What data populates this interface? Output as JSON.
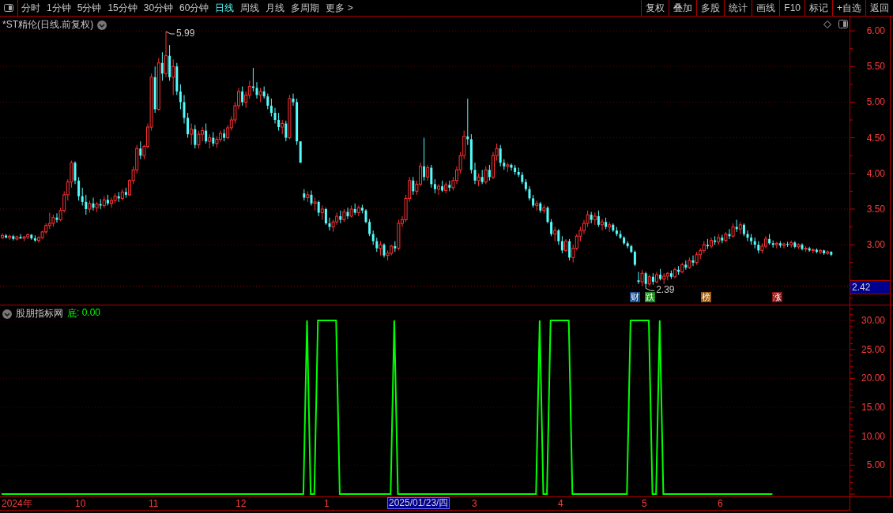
{
  "toolbar": {
    "periods": [
      {
        "label": "分时",
        "selected": false
      },
      {
        "label": "1分钟",
        "selected": false
      },
      {
        "label": "5分钟",
        "selected": false
      },
      {
        "label": "15分钟",
        "selected": false
      },
      {
        "label": "30分钟",
        "selected": false
      },
      {
        "label": "60分钟",
        "selected": false
      },
      {
        "label": "日线",
        "selected": true
      },
      {
        "label": "周线",
        "selected": false
      },
      {
        "label": "月线",
        "selected": false
      },
      {
        "label": "多周期",
        "selected": false
      },
      {
        "label": "更多 >",
        "selected": false
      }
    ],
    "actions": [
      "复权",
      "叠加",
      "多股",
      "统计",
      "画线",
      "F10",
      "标记",
      "+自选",
      "返回"
    ]
  },
  "price_panel": {
    "title": "*ST精伦(日线.前复权)",
    "high_note": "5.99",
    "low_note": "2.39",
    "markers": [
      {
        "label": "财",
        "color": "#1c4f8c"
      },
      {
        "label": "跌",
        "color": "#1c8c1c"
      },
      {
        "label": "榜",
        "color": "#a05a10"
      },
      {
        "label": "涨",
        "color": "#8c1010"
      }
    ],
    "chart_data": {
      "type": "candlestick",
      "ylim": [
        2.16,
        6.2
      ],
      "grid": true,
      "ref_lines": [
        {
          "axis": "y",
          "value": 2.42,
          "label": "2.42",
          "color": "#a00000"
        }
      ],
      "yticks": [
        {
          "value": 6,
          "label": "6.00"
        },
        {
          "value": 5.5,
          "label": "5.50"
        },
        {
          "value": 5,
          "label": "5.00"
        },
        {
          "value": 4.5,
          "label": "4.50"
        },
        {
          "value": 4,
          "label": "4.00"
        },
        {
          "value": 3.5,
          "label": "3.50"
        },
        {
          "value": 3,
          "label": "3.00"
        }
      ],
      "ohlc": [
        [
          3.1,
          3.16,
          3.08,
          3.13
        ],
        [
          3.13,
          3.15,
          3.09,
          3.1
        ],
        [
          3.1,
          3.14,
          3.07,
          3.12
        ],
        [
          3.12,
          3.14,
          3.06,
          3.08
        ],
        [
          3.08,
          3.13,
          3.06,
          3.11
        ],
        [
          3.11,
          3.15,
          3.08,
          3.09
        ],
        [
          3.09,
          3.12,
          3.05,
          3.11
        ],
        [
          3.11,
          3.16,
          3.08,
          3.14
        ],
        [
          3.14,
          3.15,
          3.07,
          3.09
        ],
        [
          3.09,
          3.13,
          3.04,
          3.06
        ],
        [
          3.06,
          3.12,
          3.03,
          3.1
        ],
        [
          3.1,
          3.2,
          3.08,
          3.18
        ],
        [
          3.18,
          3.3,
          3.15,
          3.27
        ],
        [
          3.27,
          3.45,
          3.22,
          3.3
        ],
        [
          3.3,
          3.42,
          3.25,
          3.38
        ],
        [
          3.38,
          3.44,
          3.31,
          3.35
        ],
        [
          3.35,
          3.52,
          3.33,
          3.48
        ],
        [
          3.48,
          3.75,
          3.45,
          3.7
        ],
        [
          3.7,
          3.92,
          3.62,
          3.88
        ],
        [
          3.88,
          4.18,
          3.8,
          4.15
        ],
        [
          4.15,
          4.17,
          3.85,
          3.9
        ],
        [
          3.9,
          3.95,
          3.62,
          3.68
        ],
        [
          3.68,
          3.8,
          3.55,
          3.6
        ],
        [
          3.6,
          3.7,
          3.42,
          3.5
        ],
        [
          3.5,
          3.62,
          3.45,
          3.58
        ],
        [
          3.58,
          3.66,
          3.48,
          3.52
        ],
        [
          3.52,
          3.6,
          3.46,
          3.57
        ],
        [
          3.57,
          3.64,
          3.5,
          3.55
        ],
        [
          3.55,
          3.68,
          3.52,
          3.63
        ],
        [
          3.63,
          3.7,
          3.55,
          3.58
        ],
        [
          3.58,
          3.66,
          3.52,
          3.62
        ],
        [
          3.62,
          3.72,
          3.58,
          3.68
        ],
        [
          3.68,
          3.74,
          3.6,
          3.65
        ],
        [
          3.65,
          3.78,
          3.62,
          3.74
        ],
        [
          3.74,
          3.8,
          3.66,
          3.7
        ],
        [
          3.7,
          3.92,
          3.68,
          3.9
        ],
        [
          3.9,
          4.1,
          3.85,
          4.05
        ],
        [
          4.05,
          4.4,
          4.0,
          4.35
        ],
        [
          4.35,
          4.45,
          4.2,
          4.25
        ],
        [
          4.25,
          4.4,
          4.2,
          4.38
        ],
        [
          4.38,
          4.7,
          4.35,
          4.65
        ],
        [
          4.65,
          5.4,
          4.6,
          5.35
        ],
        [
          5.35,
          5.5,
          4.85,
          4.9
        ],
        [
          4.9,
          5.62,
          4.88,
          5.55
        ],
        [
          5.55,
          5.7,
          5.3,
          5.4
        ],
        [
          5.4,
          5.99,
          5.35,
          5.65
        ],
        [
          5.65,
          5.8,
          5.3,
          5.35
        ],
        [
          5.35,
          5.6,
          5.1,
          5.5
        ],
        [
          5.5,
          5.55,
          5.1,
          5.15
        ],
        [
          5.15,
          5.25,
          4.9,
          5.0
        ],
        [
          5.0,
          5.1,
          4.7,
          4.78
        ],
        [
          4.78,
          4.85,
          4.5,
          4.55
        ],
        [
          4.55,
          4.7,
          4.4,
          4.62
        ],
        [
          4.62,
          4.68,
          4.35,
          4.4
        ],
        [
          4.4,
          4.6,
          4.35,
          4.55
        ],
        [
          4.55,
          4.65,
          4.45,
          4.6
        ],
        [
          4.6,
          4.7,
          4.42,
          4.45
        ],
        [
          4.45,
          4.55,
          4.35,
          4.5
        ],
        [
          4.5,
          4.58,
          4.38,
          4.42
        ],
        [
          4.42,
          4.52,
          4.36,
          4.48
        ],
        [
          4.48,
          4.6,
          4.44,
          4.56
        ],
        [
          4.56,
          4.62,
          4.45,
          4.5
        ],
        [
          4.5,
          4.68,
          4.48,
          4.64
        ],
        [
          4.64,
          4.8,
          4.6,
          4.75
        ],
        [
          4.75,
          5.0,
          4.7,
          4.95
        ],
        [
          4.95,
          5.2,
          4.9,
          5.15
        ],
        [
          5.15,
          5.22,
          4.95,
          5.0
        ],
        [
          5.0,
          5.15,
          4.92,
          5.1
        ],
        [
          5.1,
          5.3,
          5.05,
          5.22
        ],
        [
          5.22,
          5.48,
          5.15,
          5.2
        ],
        [
          5.2,
          5.28,
          5.05,
          5.1
        ],
        [
          5.1,
          5.2,
          5.0,
          5.15
        ],
        [
          5.15,
          5.22,
          5.05,
          5.08
        ],
        [
          5.08,
          5.12,
          4.9,
          4.95
        ],
        [
          4.95,
          5.05,
          4.8,
          4.85
        ],
        [
          4.85,
          4.92,
          4.7,
          4.75
        ],
        [
          4.75,
          4.85,
          4.6,
          4.65
        ],
        [
          4.65,
          4.75,
          4.55,
          4.7
        ],
        [
          4.7,
          4.74,
          4.45,
          4.5
        ],
        [
          4.5,
          5.1,
          4.48,
          5.05
        ],
        [
          5.05,
          5.12,
          4.95,
          5.0
        ],
        [
          5.0,
          5.05,
          4.4,
          4.45
        ],
        [
          4.45,
          4.45,
          4.15,
          4.15
        ],
        [
          3.72,
          3.78,
          3.62,
          3.66
        ],
        [
          3.66,
          3.75,
          3.6,
          3.7
        ],
        [
          3.7,
          3.76,
          3.55,
          3.58
        ],
        [
          3.58,
          3.66,
          3.48,
          3.6
        ],
        [
          3.6,
          3.62,
          3.4,
          3.45
        ],
        [
          3.45,
          3.55,
          3.35,
          3.5
        ],
        [
          3.5,
          3.52,
          3.28,
          3.3
        ],
        [
          3.3,
          3.38,
          3.2,
          3.25
        ],
        [
          3.25,
          3.35,
          3.18,
          3.32
        ],
        [
          3.32,
          3.45,
          3.28,
          3.4
        ],
        [
          3.4,
          3.48,
          3.3,
          3.35
        ],
        [
          3.35,
          3.5,
          3.32,
          3.46
        ],
        [
          3.46,
          3.52,
          3.36,
          3.4
        ],
        [
          3.4,
          3.55,
          3.38,
          3.5
        ],
        [
          3.5,
          3.58,
          3.42,
          3.45
        ],
        [
          3.45,
          3.55,
          3.4,
          3.52
        ],
        [
          3.52,
          3.56,
          3.44,
          3.48
        ],
        [
          3.48,
          3.5,
          3.3,
          3.32
        ],
        [
          3.32,
          3.36,
          3.12,
          3.15
        ],
        [
          3.15,
          3.2,
          3.0,
          3.05
        ],
        [
          3.05,
          3.1,
          2.9,
          2.95
        ],
        [
          2.95,
          3.05,
          2.85,
          3.0
        ],
        [
          3.0,
          3.02,
          2.82,
          2.85
        ],
        [
          2.85,
          2.92,
          2.78,
          2.88
        ],
        [
          2.88,
          3.0,
          2.85,
          2.98
        ],
        [
          2.98,
          3.05,
          2.9,
          2.95
        ],
        [
          2.95,
          3.35,
          2.92,
          3.3
        ],
        [
          3.3,
          3.4,
          3.25,
          3.35
        ],
        [
          3.35,
          3.7,
          3.32,
          3.65
        ],
        [
          3.65,
          3.95,
          3.6,
          3.9
        ],
        [
          3.9,
          3.95,
          3.7,
          3.75
        ],
        [
          3.75,
          3.9,
          3.7,
          3.85
        ],
        [
          3.85,
          4.15,
          3.82,
          4.1
        ],
        [
          4.1,
          4.5,
          3.9,
          3.95
        ],
        [
          3.95,
          4.12,
          3.9,
          4.08
        ],
        [
          4.08,
          4.12,
          3.8,
          3.85
        ],
        [
          3.85,
          3.92,
          3.72,
          3.78
        ],
        [
          3.78,
          3.85,
          3.7,
          3.82
        ],
        [
          3.82,
          3.9,
          3.74,
          3.76
        ],
        [
          3.76,
          3.88,
          3.72,
          3.84
        ],
        [
          3.84,
          3.9,
          3.75,
          3.8
        ],
        [
          3.8,
          3.95,
          3.76,
          3.9
        ],
        [
          3.9,
          4.1,
          3.85,
          4.05
        ],
        [
          4.05,
          4.3,
          4.0,
          4.25
        ],
        [
          4.25,
          4.6,
          4.2,
          4.52
        ],
        [
          4.52,
          5.05,
          4.4,
          4.48
        ],
        [
          4.48,
          4.55,
          4.0,
          4.05
        ],
        [
          4.05,
          4.15,
          3.85,
          3.9
        ],
        [
          3.9,
          4.0,
          3.82,
          3.95
        ],
        [
          3.95,
          4.05,
          3.85,
          3.88
        ],
        [
          3.88,
          4.1,
          3.85,
          4.05
        ],
        [
          4.05,
          4.12,
          3.9,
          3.95
        ],
        [
          3.95,
          4.3,
          3.92,
          4.25
        ],
        [
          4.25,
          4.42,
          4.18,
          4.35
        ],
        [
          4.35,
          4.4,
          4.1,
          4.15
        ],
        [
          4.15,
          4.2,
          4.05,
          4.1
        ],
        [
          4.1,
          4.15,
          4.02,
          4.12
        ],
        [
          4.12,
          4.14,
          4.04,
          4.08
        ],
        [
          4.08,
          4.12,
          3.98,
          4.02
        ],
        [
          4.02,
          4.08,
          3.95,
          3.98
        ],
        [
          3.98,
          4.02,
          3.85,
          3.88
        ],
        [
          3.88,
          3.92,
          3.75,
          3.78
        ],
        [
          3.78,
          3.82,
          3.62,
          3.65
        ],
        [
          3.65,
          3.7,
          3.52,
          3.55
        ],
        [
          3.55,
          3.62,
          3.48,
          3.58
        ],
        [
          3.58,
          3.6,
          3.45,
          3.48
        ],
        [
          3.48,
          3.56,
          3.44,
          3.52
        ],
        [
          3.52,
          3.54,
          3.3,
          3.32
        ],
        [
          3.32,
          3.36,
          3.12,
          3.15
        ],
        [
          3.15,
          3.25,
          3.05,
          3.2
        ],
        [
          3.2,
          3.22,
          3.0,
          3.05
        ],
        [
          3.05,
          3.12,
          2.88,
          2.92
        ],
        [
          2.92,
          3.08,
          2.9,
          3.05
        ],
        [
          3.05,
          3.08,
          2.78,
          2.82
        ],
        [
          2.82,
          3.0,
          2.75,
          2.95
        ],
        [
          2.95,
          3.15,
          2.92,
          3.12
        ],
        [
          3.12,
          3.25,
          3.05,
          3.2
        ],
        [
          3.2,
          3.35,
          3.15,
          3.3
        ],
        [
          3.3,
          3.48,
          3.25,
          3.42
        ],
        [
          3.42,
          3.46,
          3.3,
          3.35
        ],
        [
          3.35,
          3.45,
          3.28,
          3.4
        ],
        [
          3.4,
          3.48,
          3.25,
          3.28
        ],
        [
          3.28,
          3.36,
          3.2,
          3.32
        ],
        [
          3.32,
          3.38,
          3.22,
          3.25
        ],
        [
          3.25,
          3.32,
          3.18,
          3.28
        ],
        [
          3.28,
          3.3,
          3.18,
          3.2
        ],
        [
          3.2,
          3.25,
          3.12,
          3.15
        ],
        [
          3.15,
          3.2,
          3.08,
          3.1
        ],
        [
          3.1,
          3.12,
          3.0,
          3.02
        ],
        [
          3.02,
          3.05,
          2.95,
          2.98
        ],
        [
          2.98,
          3.0,
          2.88,
          2.9
        ],
        [
          2.9,
          2.92,
          2.7,
          2.72
        ],
        [
          2.5,
          2.62,
          2.45,
          2.48
        ],
        [
          2.48,
          2.65,
          2.42,
          2.6
        ],
        [
          2.6,
          2.62,
          2.39,
          2.45
        ],
        [
          2.45,
          2.58,
          2.42,
          2.55
        ],
        [
          2.55,
          2.6,
          2.44,
          2.48
        ],
        [
          2.48,
          2.62,
          2.46,
          2.58
        ],
        [
          2.58,
          2.66,
          2.5,
          2.52
        ],
        [
          2.52,
          2.6,
          2.45,
          2.56
        ],
        [
          2.56,
          2.62,
          2.5,
          2.6
        ],
        [
          2.6,
          2.64,
          2.52,
          2.55
        ],
        [
          2.55,
          2.68,
          2.53,
          2.65
        ],
        [
          2.65,
          2.7,
          2.58,
          2.62
        ],
        [
          2.62,
          2.75,
          2.6,
          2.72
        ],
        [
          2.72,
          2.78,
          2.65,
          2.68
        ],
        [
          2.68,
          2.82,
          2.66,
          2.78
        ],
        [
          2.78,
          2.85,
          2.7,
          2.75
        ],
        [
          2.75,
          2.9,
          2.72,
          2.86
        ],
        [
          2.86,
          2.95,
          2.8,
          2.92
        ],
        [
          2.92,
          3.05,
          2.88,
          3.0
        ],
        [
          3.0,
          3.08,
          2.94,
          2.98
        ],
        [
          2.98,
          3.1,
          2.95,
          3.06
        ],
        [
          3.06,
          3.12,
          3.0,
          3.04
        ],
        [
          3.04,
          3.15,
          3.0,
          3.1
        ],
        [
          3.1,
          3.14,
          3.02,
          3.06
        ],
        [
          3.06,
          3.18,
          3.04,
          3.15
        ],
        [
          3.15,
          3.22,
          3.08,
          3.12
        ],
        [
          3.12,
          3.3,
          3.1,
          3.25
        ],
        [
          3.25,
          3.35,
          3.18,
          3.22
        ],
        [
          3.22,
          3.32,
          3.15,
          3.28
        ],
        [
          3.28,
          3.3,
          3.12,
          3.15
        ],
        [
          3.15,
          3.2,
          3.05,
          3.1
        ],
        [
          3.1,
          3.15,
          3.0,
          3.05
        ],
        [
          3.05,
          3.1,
          2.95,
          3.0
        ],
        [
          3.0,
          3.05,
          2.88,
          2.92
        ],
        [
          2.92,
          3.02,
          2.88,
          2.98
        ],
        [
          2.98,
          3.12,
          2.95,
          3.08
        ],
        [
          3.08,
          3.15,
          3.0,
          3.02
        ],
        [
          3.02,
          3.06,
          2.96,
          3.0
        ],
        [
          3.0,
          3.04,
          2.95,
          3.02
        ],
        [
          3.02,
          3.05,
          2.96,
          2.99
        ],
        [
          2.99,
          3.03,
          2.95,
          3.01
        ],
        [
          3.01,
          3.04,
          2.97,
          3.0
        ],
        [
          3.0,
          3.06,
          2.96,
          3.03
        ],
        [
          3.03,
          3.05,
          2.95,
          2.97
        ],
        [
          2.97,
          3.02,
          2.94,
          3.0
        ],
        [
          3.0,
          3.02,
          2.92,
          2.94
        ],
        [
          2.94,
          2.98,
          2.9,
          2.95
        ],
        [
          2.95,
          2.97,
          2.9,
          2.92
        ],
        [
          2.92,
          2.95,
          2.88,
          2.93
        ],
        [
          2.93,
          2.95,
          2.88,
          2.9
        ],
        [
          2.9,
          2.94,
          2.87,
          2.92
        ],
        [
          2.92,
          2.93,
          2.86,
          2.88
        ],
        [
          2.88,
          2.92,
          2.86,
          2.9
        ],
        [
          2.9,
          2.91,
          2.84,
          2.86
        ]
      ]
    }
  },
  "indicator_panel": {
    "title": "股朋指标网",
    "legend_value": ": 0.00",
    "chart_data": {
      "type": "line",
      "grid": true,
      "ylim": [
        -0.4,
        32.6
      ],
      "categories": [
        null,
        null,
        null,
        null,
        null,
        null,
        null,
        null,
        null,
        null,
        null,
        null,
        null,
        null,
        null,
        null,
        null,
        null,
        null,
        null,
        null,
        null,
        null,
        null,
        null,
        null,
        null,
        null,
        null,
        null,
        null,
        null,
        null,
        null,
        null,
        null,
        null,
        null,
        null,
        null,
        null,
        null,
        null,
        null,
        null,
        null,
        null,
        null,
        null,
        null,
        null,
        null,
        null,
        null,
        null,
        null,
        null,
        null,
        null,
        null,
        null,
        null,
        null,
        null,
        null,
        null,
        null,
        null,
        null,
        null,
        null,
        null,
        null,
        null,
        null,
        null,
        null,
        null,
        null,
        null,
        null,
        null,
        null,
        null,
        null,
        null,
        null,
        null,
        null,
        null,
        null,
        null,
        null,
        null,
        null,
        null,
        null,
        null,
        null,
        null,
        null,
        null,
        null,
        null,
        null,
        null,
        null,
        null,
        null,
        null,
        null,
        null,
        null,
        null,
        null,
        null,
        null,
        null,
        null,
        null,
        null,
        null,
        null,
        null,
        null,
        null,
        null,
        null,
        null,
        null,
        null,
        null,
        null,
        null,
        null,
        null,
        null,
        null,
        null,
        null,
        null,
        null,
        null,
        null,
        null,
        null,
        null,
        null,
        null,
        null,
        null,
        null,
        null,
        null,
        null,
        null,
        null,
        null,
        null,
        null,
        null,
        null,
        null,
        null,
        null,
        null,
        null,
        null,
        null,
        null,
        null,
        null,
        null,
        null,
        null,
        null,
        null,
        null,
        null,
        null,
        null,
        null,
        null,
        null,
        null,
        null,
        null,
        null,
        null,
        null,
        null,
        null,
        null,
        null,
        null,
        null,
        null,
        null,
        null,
        null,
        null,
        null,
        null,
        null,
        null,
        null,
        null,
        null,
        null,
        null,
        null,
        null,
        null,
        null,
        null,
        null,
        null,
        null,
        null,
        null,
        null,
        null,
        null,
        null,
        null,
        null,
        null,
        null,
        null,
        null,
        null,
        null,
        null,
        null
      ],
      "series": [
        {
          "name": "底",
          "color": "#00ff00",
          "values": [
            0,
            0,
            0,
            0,
            0,
            0,
            0,
            0,
            0,
            0,
            0,
            0,
            0,
            0,
            0,
            0,
            0,
            0,
            0,
            0,
            0,
            0,
            0,
            0,
            0,
            0,
            0,
            0,
            0,
            0,
            0,
            0,
            0,
            0,
            0,
            0,
            0,
            0,
            0,
            0,
            0,
            0,
            0,
            0,
            0,
            0,
            0,
            0,
            0,
            0,
            0,
            0,
            0,
            0,
            0,
            0,
            0,
            0,
            0,
            0,
            0,
            0,
            0,
            0,
            0,
            0,
            0,
            0,
            0,
            0,
            0,
            0,
            0,
            0,
            0,
            0,
            0,
            0,
            0,
            0,
            0,
            0,
            0,
            0,
            30,
            0,
            0,
            30,
            30,
            30,
            30,
            30,
            30,
            0,
            0,
            0,
            0,
            0,
            0,
            0,
            0,
            0,
            0,
            0,
            0,
            0,
            0,
            0,
            30,
            0,
            0,
            0,
            0,
            0,
            0,
            0,
            0,
            0,
            0,
            0,
            0,
            0,
            0,
            0,
            0,
            0,
            0,
            0,
            0,
            0,
            0,
            0,
            0,
            0,
            0,
            0,
            0,
            0,
            0,
            0,
            0,
            0,
            0,
            0,
            0,
            0,
            0,
            0,
            30,
            0,
            0,
            30,
            30,
            30,
            30,
            30,
            30,
            0,
            0,
            0,
            0,
            0,
            0,
            0,
            0,
            0,
            0,
            0,
            0,
            0,
            0,
            0,
            0,
            30,
            30,
            30,
            30,
            30,
            30,
            0,
            0,
            30,
            0,
            0,
            0,
            0,
            0,
            0,
            0,
            0,
            0,
            0,
            0,
            0,
            0,
            0,
            0,
            0,
            0,
            0,
            0,
            0,
            0,
            0,
            0,
            0,
            0,
            0,
            0,
            0,
            0,
            0,
            0,
            null,
            null,
            null,
            null,
            null,
            null,
            null,
            null,
            null,
            null,
            null,
            null,
            null,
            null,
            null,
            null,
            null,
            null,
            null,
            null,
            null
          ]
        }
      ],
      "yticks": [
        {
          "value": 30,
          "label": "30.00"
        },
        {
          "value": 25,
          "label": "25.00"
        },
        {
          "value": 20,
          "label": "20.00"
        },
        {
          "value": 15,
          "label": "15.00"
        },
        {
          "value": 10,
          "label": "10.00"
        },
        {
          "value": 5,
          "label": "5.00"
        }
      ]
    }
  },
  "time_axis": {
    "labels": [
      "2024年",
      "10",
      "11",
      "12",
      "1",
      "3",
      "4",
      "5",
      "6"
    ],
    "cursor_date": "2025/01/23/四"
  }
}
